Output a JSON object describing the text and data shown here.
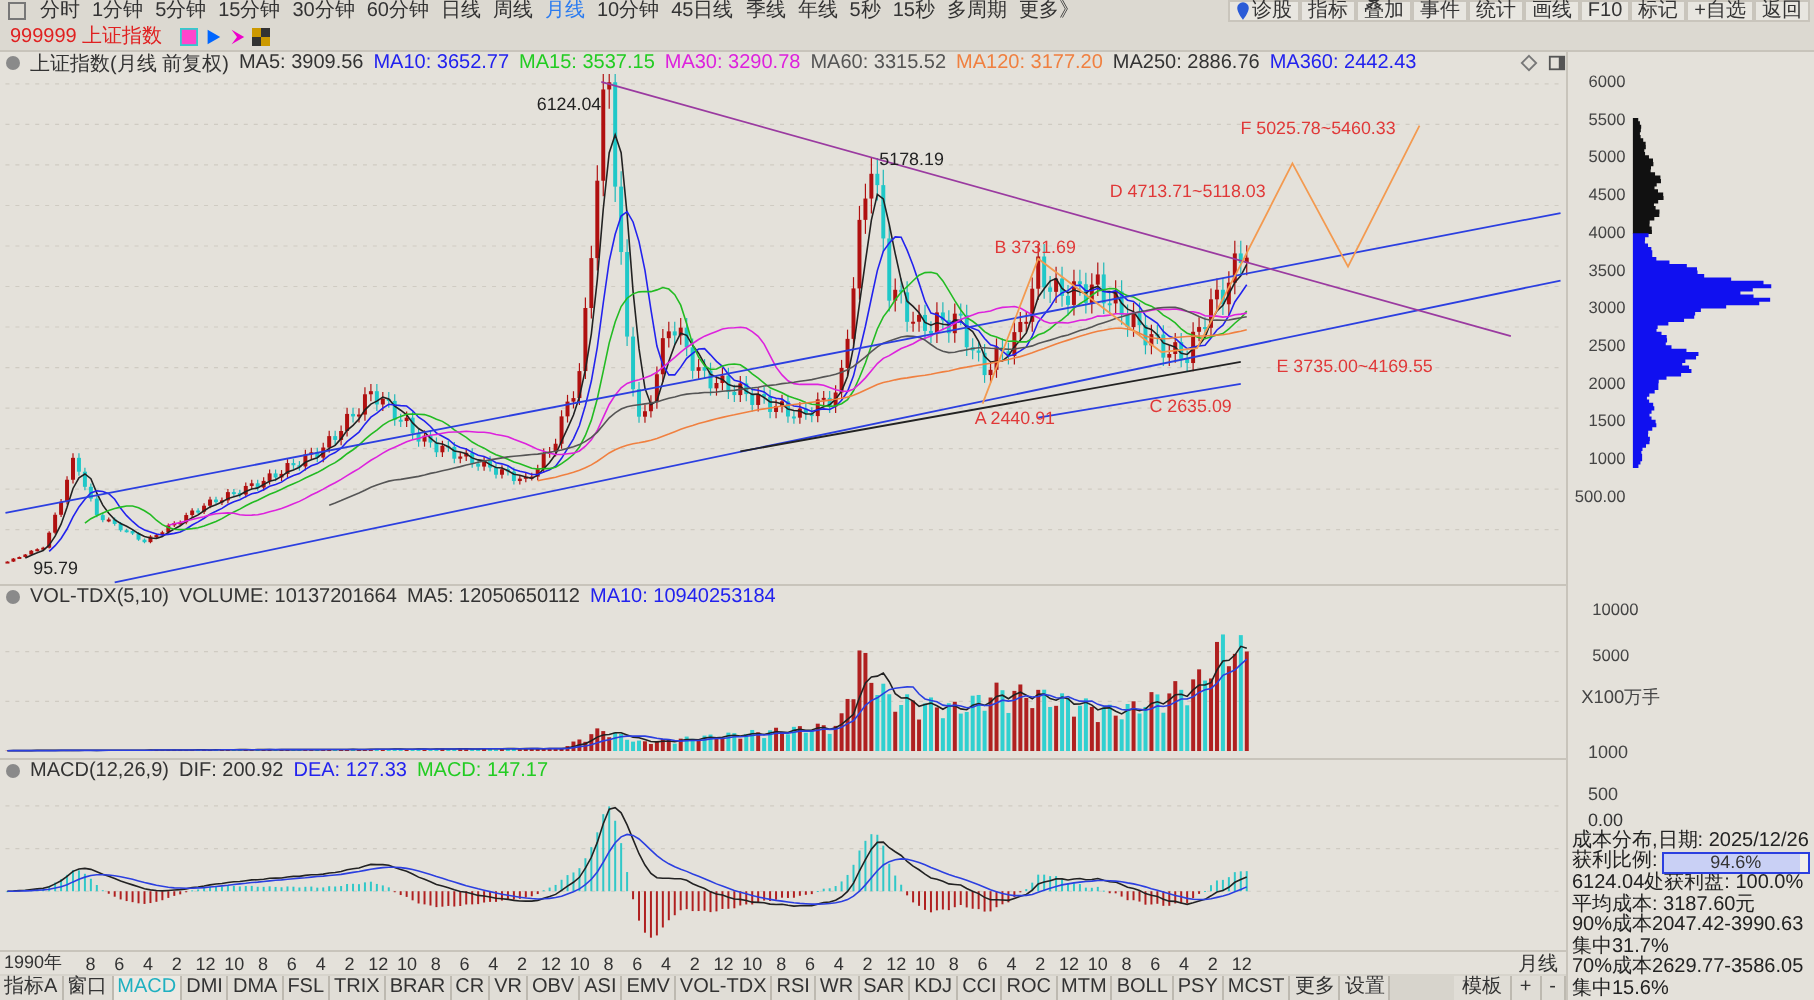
{
  "toolbar": {
    "periods": [
      {
        "label": "分时",
        "selected": false
      },
      {
        "label": "1分钟",
        "selected": false
      },
      {
        "label": "5分钟",
        "selected": false
      },
      {
        "label": "15分钟",
        "selected": false
      },
      {
        "label": "30分钟",
        "selected": false
      },
      {
        "label": "60分钟",
        "selected": false
      },
      {
        "label": "日线",
        "selected": false
      },
      {
        "label": "周线",
        "selected": false
      },
      {
        "label": "月线",
        "selected": true
      },
      {
        "label": "10分钟",
        "selected": false
      },
      {
        "label": "45日线",
        "selected": false
      },
      {
        "label": "季线",
        "selected": false
      },
      {
        "label": "年线",
        "selected": false
      },
      {
        "label": "5秒",
        "selected": false
      },
      {
        "label": "15秒",
        "selected": false
      },
      {
        "label": "多周期",
        "selected": false
      },
      {
        "label": "更多》",
        "selected": false
      }
    ],
    "buttons": [
      "诊股",
      "指标",
      "叠加",
      "事件",
      "统计",
      "画线",
      "F10",
      "标记",
      "+自选",
      "返回"
    ],
    "security": "999999 上证指数"
  },
  "main_chart": {
    "title": "上证指数(月线 前复权)",
    "averages": [
      {
        "label": "MA5: 3909.56",
        "color": "#333333"
      },
      {
        "label": "MA10: 3652.77",
        "color": "#2222ee"
      },
      {
        "label": "MA15: 3537.15",
        "color": "#22cc22"
      },
      {
        "label": "MA30: 3290.78",
        "color": "#dd22dd"
      },
      {
        "label": "MA60: 3315.52",
        "color": "#555555"
      },
      {
        "label": "MA120: 3177.20",
        "color": "#f08040"
      },
      {
        "label": "MA250: 2886.76",
        "color": "#333333"
      },
      {
        "label": "MA360: 2442.43",
        "color": "#2222ee"
      }
    ],
    "y_labels": [
      "6000",
      "5500",
      "5000",
      "4500",
      "4000",
      "3500",
      "3000",
      "2500",
      "2000",
      "1500",
      "1000",
      "500.00"
    ],
    "annotations": [
      {
        "text": "6124.04",
        "kind": "high"
      },
      {
        "text": "F 5025.78~5460.33",
        "kind": "wave"
      },
      {
        "text": "5178.19",
        "kind": "high"
      },
      {
        "text": "D 4713.71~5118.03",
        "kind": "wave"
      },
      {
        "text": "B 3731.69",
        "kind": "wave"
      },
      {
        "text": "E 3735.00~4169.55",
        "kind": "wave"
      },
      {
        "text": "C 2635.09",
        "kind": "wave"
      },
      {
        "text": "A 2440.91",
        "kind": "wave"
      },
      {
        "text": "95.79",
        "kind": "low"
      }
    ]
  },
  "volume_panel": {
    "title": "VOL-TDX(5,10)",
    "items": [
      {
        "label": "VOLUME: 10137201664",
        "color": "#333333"
      },
      {
        "label": "MA5: 12050650112",
        "color": "#333333"
      },
      {
        "label": "MA10: 10940253184",
        "color": "#2222ee"
      }
    ],
    "y_labels": [
      "10000",
      "5000",
      "X100万手"
    ]
  },
  "macd_panel": {
    "title": "MACD(12,26,9)",
    "items": [
      {
        "label": "DIF: 200.92",
        "color": "#333333"
      },
      {
        "label": "DEA: 127.33",
        "color": "#2222ee"
      },
      {
        "label": "MACD: 147.17",
        "color": "#22cc22"
      }
    ],
    "y_labels": [
      "1000",
      "500",
      "0.00"
    ]
  },
  "cost_distribution": {
    "title": "成本分布,日期: 2025/12/26",
    "profit_ratio": {
      "label": "获利比例:",
      "level": 0.946,
      "reading": "94.6%"
    },
    "lines": [
      "6124.04处获利盘: 100.0%",
      "平均成本: 3187.60元",
      "90%成本2047.42-3990.63集中31.7%",
      "70%成本2629.77-3586.05集中15.6%"
    ]
  },
  "x_axis": {
    "labels": [
      "1990年",
      "8",
      "6",
      "4",
      "2",
      "12",
      "10",
      "8",
      "6",
      "4",
      "2",
      "12",
      "10",
      "8",
      "6",
      "4",
      "2",
      "12",
      "10",
      "8",
      "6",
      "4",
      "2",
      "12",
      "10",
      "8",
      "6",
      "4",
      "2",
      "12",
      "10",
      "8",
      "6",
      "4",
      "2",
      "12",
      "10",
      "8",
      "6",
      "4",
      "2",
      "12"
    ],
    "period": "月线"
  },
  "indicator_tabs": [
    {
      "label": "指标A",
      "selected": false
    },
    {
      "label": "窗口",
      "selected": false
    },
    {
      "label": "MACD",
      "selected": true
    },
    {
      "label": "DMI",
      "selected": false
    },
    {
      "label": "DMA",
      "selected": false
    },
    {
      "label": "FSL",
      "selected": false
    },
    {
      "label": "TRIX",
      "selected": false
    },
    {
      "label": "BRAR",
      "selected": false
    },
    {
      "label": "CR",
      "selected": false
    },
    {
      "label": "VR",
      "selected": false
    },
    {
      "label": "OBV",
      "selected": false
    },
    {
      "label": "ASI",
      "selected": false
    },
    {
      "label": "EMV",
      "selected": false
    },
    {
      "label": "VOL-TDX",
      "selected": false
    },
    {
      "label": "RSI",
      "selected": false
    },
    {
      "label": "WR",
      "selected": false
    },
    {
      "label": "SAR",
      "selected": false
    },
    {
      "label": "KDJ",
      "selected": false
    },
    {
      "label": "CCI",
      "selected": false
    },
    {
      "label": "ROC",
      "selected": false
    },
    {
      "label": "MTM",
      "selected": false
    },
    {
      "label": "BOLL",
      "selected": false
    },
    {
      "label": "PSY",
      "selected": false
    },
    {
      "label": "MCST",
      "selected": false
    },
    {
      "label": "更多",
      "selected": false
    },
    {
      "label": "设置",
      "selected": false
    }
  ],
  "tab_controls": [
    "模板",
    "+",
    "-"
  ]
}
